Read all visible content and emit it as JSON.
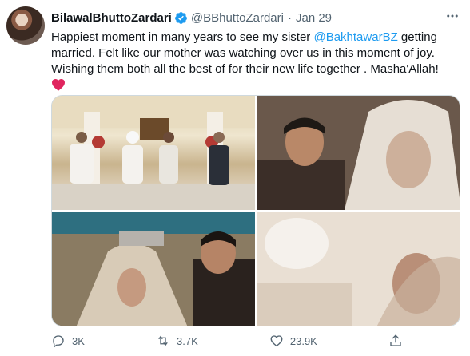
{
  "tweet": {
    "author_name": "BilawalBhuttoZardari",
    "handle": "@BBhuttoZardari",
    "separator": "·",
    "date": "Jan 29",
    "text_line1_pre": "Happiest moment in many years to see my sister ",
    "mention": "@BakhtawarBZ",
    "text_line1_post": " getting married. Felt like our mother was watching over us in this moment of joy. Wishing them both all the best of for their new life together . Masha'Allah!",
    "emoji": "red-heart-icon",
    "verified_icon": "verified-badge-icon",
    "accent_color": "#1d9bf0",
    "heart_color": "#e0245e"
  },
  "media": {
    "photos": [
      "wedding-ceremony-group-photo",
      "man-beside-veiled-bride-photo",
      "man-holding-quran-over-bride-photo",
      "bride-under-veil-closeup-photo"
    ]
  },
  "actions": {
    "reply_count": "3K",
    "retweet_count": "3.7K",
    "like_count": "23.9K"
  }
}
